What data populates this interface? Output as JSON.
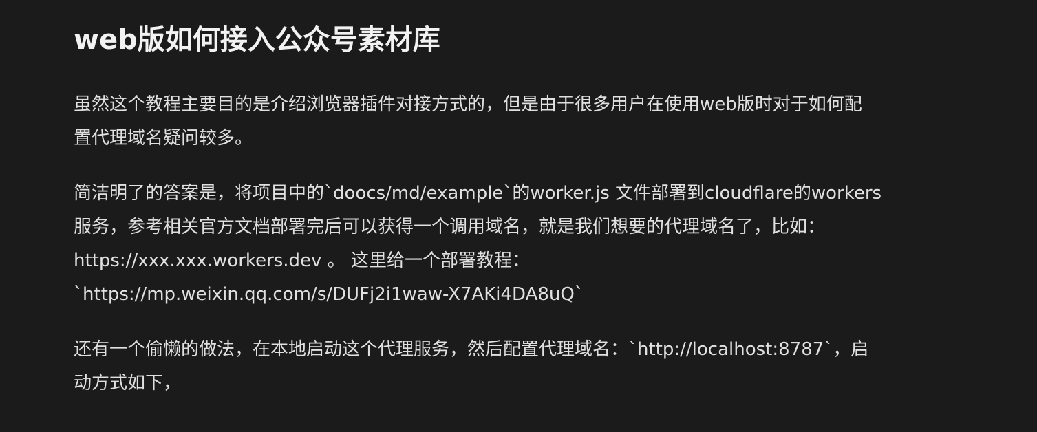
{
  "article": {
    "heading": "web版如何接入公众号素材库",
    "paragraphs": [
      "虽然这个教程主要目的是介绍浏览器插件对接方式的，但是由于很多用户在使用web版时对于如何配\n置代理域名疑问较多。",
      "简洁明了的答案是，将项目中的`doocs/md/example`的worker.js 文件部署到cloudflare的workers\n服务，参考相关官方文档部署完后可以获得一个调用域名，就是我们想要的代理域名了，比如：\nhttps://xxx.xxx.workers.dev 。 这里给一个部署教程：\n`https://mp.weixin.qq.com/s/DUFj2i1waw-X7AKi4DA8uQ`",
      "还有一个偷懒的做法，在本地启动这个代理服务，然后配置代理域名：`http://localhost:8787`，启\n动方式如下，"
    ]
  }
}
